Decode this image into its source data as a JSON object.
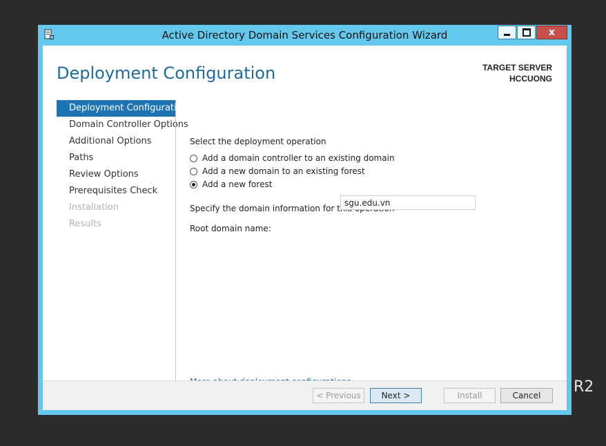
{
  "background": {
    "text": "R2"
  },
  "window": {
    "title": "Active Directory Domain Services Configuration Wizard",
    "controls": {
      "minimize": "minimize",
      "maximize": "maximize",
      "close": "x"
    }
  },
  "header": {
    "page_title": "Deployment Configuration",
    "target_label": "TARGET SERVER",
    "target_name": "HCCUONG"
  },
  "nav": {
    "items": [
      {
        "label": "Deployment Configuration",
        "state": "active"
      },
      {
        "label": "Domain Controller Options",
        "state": "enabled"
      },
      {
        "label": "Additional Options",
        "state": "enabled"
      },
      {
        "label": "Paths",
        "state": "enabled"
      },
      {
        "label": "Review Options",
        "state": "enabled"
      },
      {
        "label": "Prerequisites Check",
        "state": "enabled"
      },
      {
        "label": "Installation",
        "state": "disabled"
      },
      {
        "label": "Results",
        "state": "disabled"
      }
    ]
  },
  "main": {
    "operation_heading": "Select the deployment operation",
    "operations": [
      {
        "label": "Add a domain controller to an existing domain",
        "checked": false
      },
      {
        "label": "Add a new domain to an existing forest",
        "checked": false
      },
      {
        "label": "Add a new forest",
        "checked": true
      }
    ],
    "domain_heading": "Specify the domain information for this operation",
    "root_domain_label": "Root domain name:",
    "root_domain_value": "sgu.edu.vn",
    "more_link": "More about deployment configurations"
  },
  "footer": {
    "previous": "< Previous",
    "next": "Next >",
    "install": "Install",
    "cancel": "Cancel"
  },
  "colors": {
    "window_frame": "#64c8ec",
    "accent_blue": "#1e73b4",
    "title_blue": "#1f6b9e",
    "close_red": "#c7504a"
  }
}
